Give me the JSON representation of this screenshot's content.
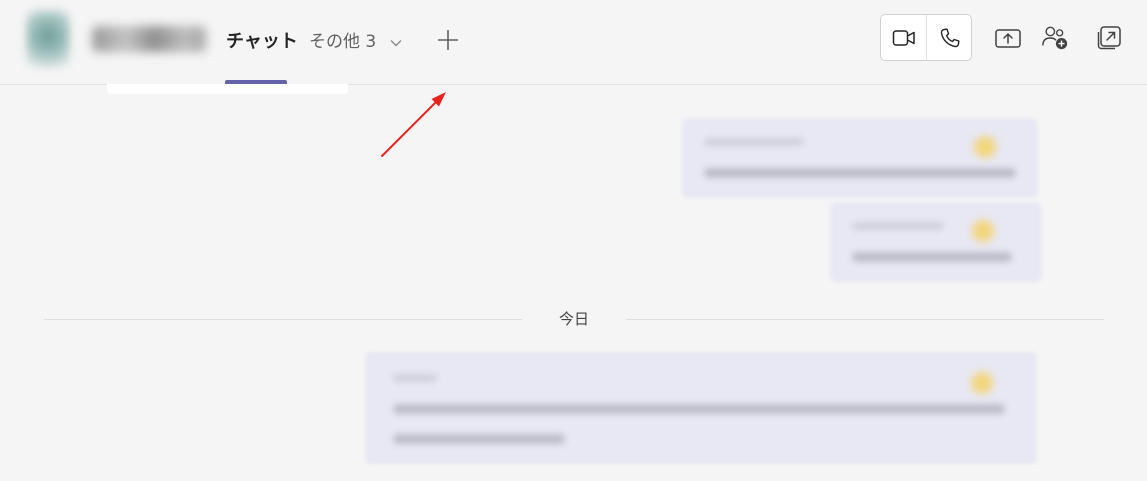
{
  "header": {
    "tabs": [
      {
        "label": "チャット",
        "active": true
      },
      {
        "label": "その他 3",
        "active": false
      }
    ],
    "icons": {
      "add_tab": "plus-icon",
      "video_call": "video-camera-icon",
      "audio_call": "phone-icon",
      "share_screen": "share-screen-icon",
      "add_people": "add-people-icon",
      "pop_out": "pop-out-icon"
    }
  },
  "messages": {
    "date_divider": "今日"
  },
  "colors": {
    "accent": "#6264a7",
    "background": "#f5f5f5",
    "bubble": "#e8e8f4",
    "annotation_arrow": "#e8231f"
  }
}
